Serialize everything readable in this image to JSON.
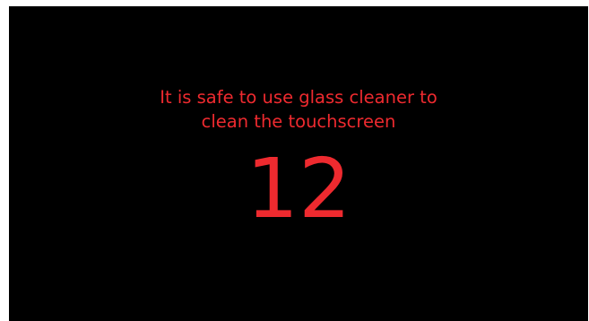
{
  "screen": {
    "background_color": "#000000",
    "text_color": "#ee2a2f",
    "message_lines": [
      "It is safe to use glass cleaner to",
      "clean the touchscreen"
    ],
    "countdown": "12"
  }
}
